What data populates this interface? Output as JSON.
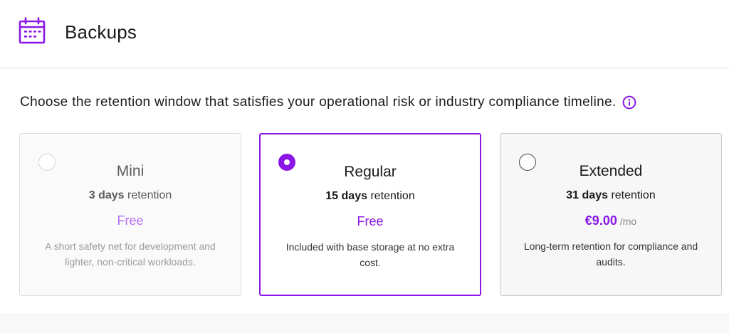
{
  "header": {
    "title": "Backups",
    "icon": "calendar-icon",
    "accent": "#8a17e6"
  },
  "intro": {
    "text": "Choose the retention window that satisfies your operational risk or industry compliance timeline.",
    "info_icon": "info-icon"
  },
  "plans": [
    {
      "name": "Mini",
      "retention_bold": "3 days",
      "retention_rest": " retention",
      "price": "Free",
      "per": "",
      "note": "A short safety net for development and lighter, non-critical workloads.",
      "state": "disabled"
    },
    {
      "name": "Regular",
      "retention_bold": "15 days",
      "retention_rest": " retention",
      "price": "Free",
      "per": "",
      "note": "Included with base storage at no extra cost.",
      "state": "selected"
    },
    {
      "name": "Extended",
      "retention_bold": "31 days",
      "retention_rest": " retention",
      "price": "€9.00",
      "per": "/mo",
      "note": "Long-term retention for compliance and audits.",
      "state": "unselected"
    }
  ]
}
